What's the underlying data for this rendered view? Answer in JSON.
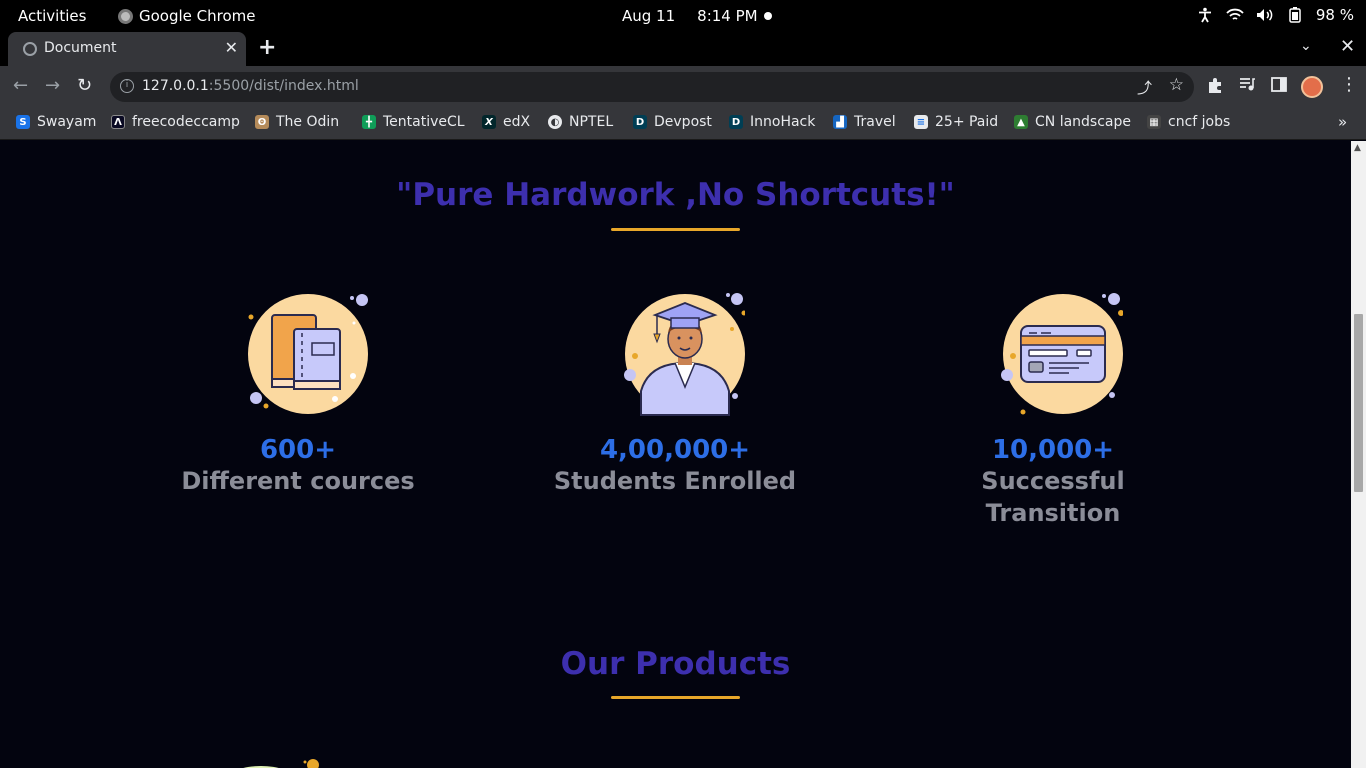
{
  "system_bar": {
    "activities": "Activities",
    "app_name": "Google Chrome",
    "date": "Aug 11",
    "time": "8:14 PM",
    "battery": "98 %"
  },
  "browser": {
    "tab_title": "Document",
    "url_host": "127.0.0.1",
    "url_path": ":5500/dist/index.html",
    "bookmarks": [
      {
        "label": "Swayam",
        "icon": "swayam-icon",
        "color": "#1a73e8"
      },
      {
        "label": "freecodeccamp",
        "icon": "freecodecamp-icon",
        "color": "#0a0a23"
      },
      {
        "label": "The Odin",
        "icon": "odin-icon",
        "color": "#b58b5a"
      },
      {
        "label": "TentativeCL",
        "icon": "sheets-icon",
        "color": "#0f9d58"
      },
      {
        "label": "edX",
        "icon": "edx-icon",
        "color": "#02262b"
      },
      {
        "label": "NPTEL",
        "icon": "globe-icon",
        "color": "#5f6368"
      },
      {
        "label": "Devpost",
        "icon": "devpost-icon",
        "color": "#003e54"
      },
      {
        "label": "InnoHack",
        "icon": "devpost-icon",
        "color": "#003e54"
      },
      {
        "label": "Travel",
        "icon": "travel-icon",
        "color": "#1565c0"
      },
      {
        "label": "25+ Paid",
        "icon": "doc-icon",
        "color": "#e8eaed"
      },
      {
        "label": "CN landscape",
        "icon": "cncf-landscape-icon",
        "color": "#2e7d32"
      },
      {
        "label": "cncf jobs",
        "icon": "cncf-jobs-icon",
        "color": "#444"
      }
    ]
  },
  "page": {
    "faded_text": "··········· ·· ·· ·· ··",
    "motto": "\"Pure Hardwork ,No Shortcuts!\"",
    "stats": [
      {
        "value": "600+",
        "label_line1": "Different cources",
        "label_line2": "",
        "icon": "books-icon"
      },
      {
        "value": "4,00,000+",
        "label_line1": "Students Enrolled",
        "label_line2": "",
        "icon": "graduate-student-icon"
      },
      {
        "value": "10,000+",
        "label_line1": "Successful",
        "label_line2": "Transition",
        "icon": "id-card-icon"
      }
    ],
    "products_title": "Our Products"
  },
  "colors": {
    "heading": "#3d2fae",
    "accent_underline": "#e8a72a",
    "stat_value": "#2d6ee6",
    "stat_label": "#8b8d98",
    "background": "#03040f"
  }
}
